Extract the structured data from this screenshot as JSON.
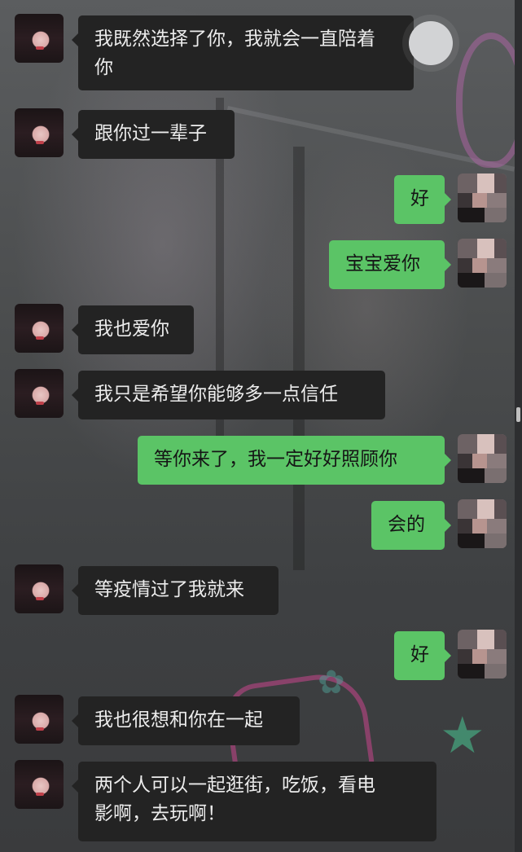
{
  "colors": {
    "incoming_bubble": "#232323",
    "incoming_text": "#ececec",
    "outgoing_bubble": "#5bc466",
    "outgoing_text": "#151515"
  },
  "messages": [
    {
      "side": "in",
      "avatar": "her-avatar-icon",
      "text": "我既然选择了你，我就会一直陪着\n你"
    },
    {
      "side": "in",
      "avatar": "her-avatar-icon",
      "text": "跟你过一辈子"
    },
    {
      "side": "out",
      "avatar": "my-avatar-icon",
      "text": "好"
    },
    {
      "side": "out",
      "avatar": "my-avatar-icon",
      "text": "宝宝爱你"
    },
    {
      "side": "in",
      "avatar": "her-avatar-icon",
      "text": "我也爱你"
    },
    {
      "side": "in",
      "avatar": "her-avatar-icon",
      "text": "我只是希望你能够多一点信任"
    },
    {
      "side": "out",
      "avatar": "my-avatar-icon",
      "text": "等你来了，我一定好好照顾你"
    },
    {
      "side": "out",
      "avatar": "my-avatar-icon",
      "text": "会的"
    },
    {
      "side": "in",
      "avatar": "her-avatar-icon",
      "text": "等疫情过了我就来"
    },
    {
      "side": "out",
      "avatar": "my-avatar-icon",
      "text": "好"
    },
    {
      "side": "in",
      "avatar": "her-avatar-icon",
      "text": "我也很想和你在一起"
    },
    {
      "side": "in",
      "avatar": "her-avatar-icon",
      "text": "两个人可以一起逛街，吃饭，看电\n影啊，去玩啊！"
    }
  ]
}
